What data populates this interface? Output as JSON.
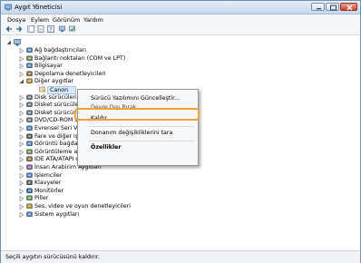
{
  "window": {
    "title": "Aygıt Yöneticisi"
  },
  "menu": {
    "items": [
      "Dosya",
      "Eylem",
      "Görünüm",
      "Yardım"
    ]
  },
  "tree": {
    "root": "",
    "items": [
      {
        "label": "Ağ bağdaştırıcıları"
      },
      {
        "label": "Bağlantı noktaları (COM ve LPT)"
      },
      {
        "label": "Bilgisayar"
      },
      {
        "label": "Depolama denetleyicileri"
      },
      {
        "label": "Diğer aygıtlar"
      },
      {
        "label": "Canon"
      },
      {
        "label": "Disk sürücüleri"
      },
      {
        "label": "Disket sürücüleri"
      },
      {
        "label": "Disket sürücüsü d"
      },
      {
        "label": "DVD/CD-ROM sür"
      },
      {
        "label": "Evrensel Seri Veri"
      },
      {
        "label": "Fare ve diğer işare"
      },
      {
        "label": "Görüntü bağdaştırı"
      },
      {
        "label": "Görüntüleme aygıtları"
      },
      {
        "label": "IDE ATA/ATAPI denetleyiciler"
      },
      {
        "label": "İnsan Arabirim Aygıtları"
      },
      {
        "label": "İşlemciler"
      },
      {
        "label": "Klavyeler"
      },
      {
        "label": "Monitörler"
      },
      {
        "label": "Piller"
      },
      {
        "label": "Ses, video ve oyun denetleyicileri"
      },
      {
        "label": "Sistem aygıtları"
      }
    ]
  },
  "context_menu": {
    "items": [
      "Sürücü Yazılımını Güncelleştir...",
      "Devre Dışı Bırak",
      "Kaldır",
      "Donanım değişikliklerini tara",
      "Özellikler"
    ]
  },
  "status": {
    "text": "Seçili aygıtın sürücüsünü kaldırır."
  }
}
